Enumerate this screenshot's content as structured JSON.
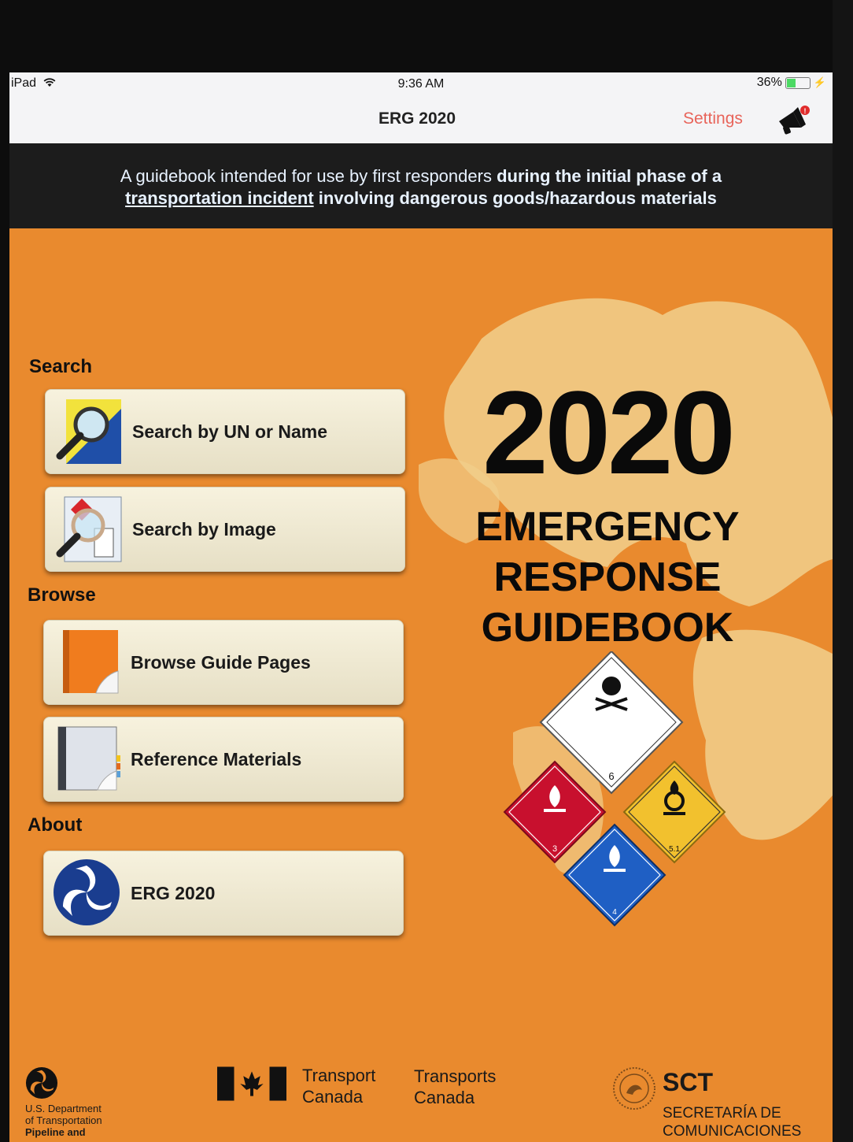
{
  "status_bar": {
    "device": "iPad",
    "time": "9:36 AM",
    "battery": "36%",
    "battery_level": 0.36
  },
  "nav": {
    "title": "ERG 2020",
    "settings_label": "Settings"
  },
  "banner": {
    "part1": "A guidebook intended for use by first responders ",
    "part2": "during the initial phase of a",
    "link": "transportation incident",
    "part3": " involving dangerous goods/hazardous materials"
  },
  "sections": {
    "search": "Search",
    "browse": "Browse",
    "about": "About"
  },
  "buttons": {
    "search_un": "Search by UN or Name",
    "search_image": "Search by Image",
    "browse_guide": "Browse Guide Pages",
    "reference": "Reference Materials",
    "about_erg": "ERG 2020"
  },
  "cover": {
    "year": "2020",
    "title_line1": "EMERGENCY",
    "title_line2": "RESPONSE",
    "title_line3": "GUIDEBOOK",
    "placard_6": "6",
    "placard_3": "3",
    "placard_51": "5.1",
    "placard_4": "4"
  },
  "footer": {
    "usdot_line1": "U.S. Department",
    "usdot_line2": "of Transportation",
    "usdot_line3": "Pipeline and",
    "tc_en_line1": "Transport",
    "tc_en_line2": "Canada",
    "tc_fr_line1": "Transports",
    "tc_fr_line2": "Canada",
    "sct_abbr": "SCT",
    "sct_line1": "SECRETARÍA DE",
    "sct_line2": "COMUNICACIONES"
  },
  "colors": {
    "background": "#e98a2e",
    "accent": "#e8645a",
    "banner": "#1c1c1c"
  }
}
